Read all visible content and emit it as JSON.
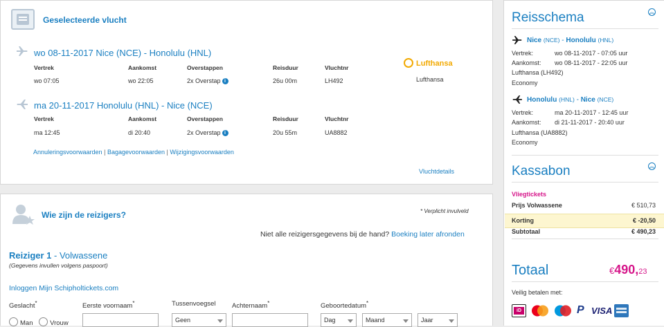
{
  "selected_flight": {
    "title": "Geselecteerde vlucht",
    "columns": [
      "Vertrek",
      "Aankomst",
      "Overstappen",
      "Reisduur",
      "Vluchtnr"
    ],
    "outbound": {
      "route": "wo 08-11-2017 Nice (NCE) - Honolulu (HNL)",
      "departure": "wo 07:05",
      "arrival": "wo 22:05",
      "stops": "2x Overstap",
      "duration": "26u 00m",
      "flight_no": "LH492",
      "airline_logo": "Lufthansa",
      "airline_name": "Lufthansa"
    },
    "inbound": {
      "route": "ma 20-11-2017 Honolulu (HNL) - Nice (NCE)",
      "departure": "ma 12:45",
      "arrival": "di 20:40",
      "stops": "2x Overstap",
      "duration": "20u 55m",
      "flight_no": "UA8882"
    },
    "links": [
      "Annuleringsvoorwaarden",
      "Bagagevoorwaarden",
      "Wijzigingsvoorwaarden"
    ],
    "link_separator": "|",
    "details_link": "Vluchtdetails"
  },
  "travelers": {
    "title": "Wie zijn de reizigers?",
    "required_note": "* Verplicht invulveld",
    "question": "Niet alle reizigersgegevens bij de hand?",
    "later_link": "Boeking later afronden",
    "traveler_label": "Reiziger 1",
    "traveler_type": " - Volwassene",
    "passport_note": "(Gegevens invullen volgens paspoort)",
    "login_link": "Inloggen Mijn Schipholtickets.com",
    "fields": {
      "gender": "Geslacht",
      "first_name": "Eerste voornaam",
      "infix": "Tussenvoegsel",
      "last_name": "Achternaam",
      "birthdate": "Geboortedatum"
    },
    "required_mark": "*",
    "gender_options": [
      "Man",
      "Vrouw"
    ],
    "infix_value": "Geen",
    "day_value": "Dag",
    "month_value": "Maand",
    "year_value": "Jaar"
  },
  "itinerary": {
    "title": "Reisschema",
    "outbound": {
      "route_from": "Nice",
      "code_from": "(NCE)",
      "route_to": "Honolulu",
      "code_to": "(HNL)",
      "dash": "-",
      "dep_label": "Vertrek:",
      "dep_value": "wo 08-11-2017 - 07:05 uur",
      "arr_label": "Aankomst:",
      "arr_value": "wo 08-11-2017 - 22:05 uur",
      "airline": "Lufthansa (LH492)",
      "class": "Economy"
    },
    "inbound": {
      "route_from": "Honolulu",
      "code_from": "(HNL)",
      "route_to": "Nice",
      "code_to": "(NCE)",
      "dash": "-",
      "dep_label": "Vertrek:",
      "dep_value": "ma 20-11-2017 - 12:45 uur",
      "arr_label": "Aankomst:",
      "arr_value": "di 21-11-2017 - 20:40 uur",
      "airline": "Lufthansa (UA8882)",
      "class": "Economy"
    }
  },
  "receipt": {
    "title": "Kassabon",
    "section": "Vliegtickets",
    "rows": [
      {
        "label": "Prijs Volwassene",
        "value": "€ 510,73"
      },
      {
        "label": "Korting",
        "value": "€ -20,50"
      },
      {
        "label": "Subtotaal",
        "value": "€ 490,23"
      }
    ],
    "total_label": "Totaal",
    "total_currency": "€",
    "total_main": "490,",
    "total_cents": "23",
    "safe_pay": "Veilig betalen met:",
    "payment_icons": [
      "ideal-icon",
      "mastercard-icon",
      "maestro-icon",
      "paypal-icon",
      "visa-icon",
      "amex-icon"
    ],
    "payment_labels": {
      "ideal": "iD",
      "paypal": "P",
      "visa": "VISA"
    }
  },
  "colors": {
    "accent": "#1a7fc1",
    "magenta": "#d6168a",
    "highlight": "#fdf6d0"
  }
}
